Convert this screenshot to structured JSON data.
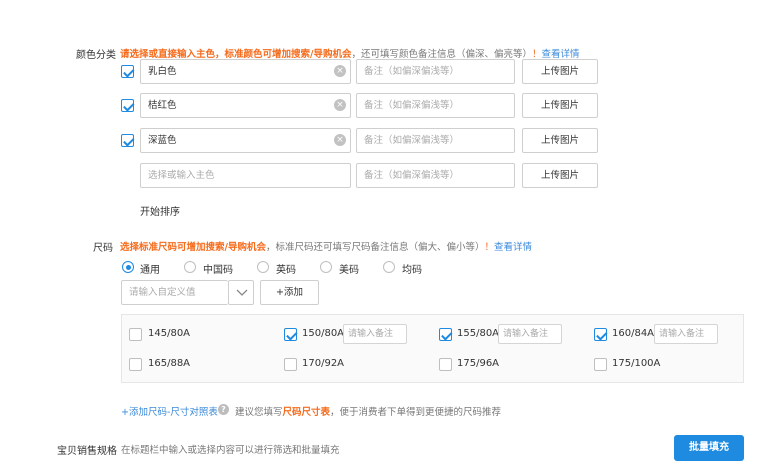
{
  "color_section": {
    "label": "颜色分类",
    "hint_orange": "请选择或直接输入主色，标准颜色可增加搜索/导购机会",
    "hint_gray": "，还可填写颜色备注信息（偏深、偏亮等）",
    "hint_excl": "！",
    "hint_link": "查看详情",
    "rows": [
      {
        "checked": true,
        "value": "乳白色",
        "note_placeholder": "备注（如偏深偏浅等）",
        "upload_label": "上传图片"
      },
      {
        "checked": true,
        "value": "桔红色",
        "note_placeholder": "备注（如偏深偏浅等）",
        "upload_label": "上传图片"
      },
      {
        "checked": true,
        "value": "深蓝色",
        "note_placeholder": "备注（如偏深偏浅等）",
        "upload_label": "上传图片"
      }
    ],
    "empty_row": {
      "placeholder": "选择或输入主色",
      "note_placeholder": "备注（如偏深偏浅等）",
      "upload_label": "上传图片"
    },
    "sort_label": "开始排序"
  },
  "size_section": {
    "label": "尺码",
    "hint_orange": "选择标准尺码可增加搜索/导购机会",
    "hint_gray": "，标准尺码还可填写尺码备注信息（偏大、偏小等）",
    "hint_excl": "！",
    "hint_link": "查看详情",
    "radios": [
      {
        "label": "通用",
        "selected": true
      },
      {
        "label": "中国码",
        "selected": false
      },
      {
        "label": "英码",
        "selected": false
      },
      {
        "label": "美码",
        "selected": false
      },
      {
        "label": "均码",
        "selected": false
      }
    ],
    "custom_placeholder": "请输入自定义值",
    "add_label": "+添加",
    "sizes": [
      {
        "label": "145/80A",
        "checked": false,
        "note_placeholder": ""
      },
      {
        "label": "150/80A",
        "checked": true,
        "note_placeholder": "请输入备注"
      },
      {
        "label": "155/80A",
        "checked": true,
        "note_placeholder": "请输入备注"
      },
      {
        "label": "160/84A",
        "checked": true,
        "note_placeholder": "请输入备注"
      },
      {
        "label": "165/88A",
        "checked": false,
        "note_placeholder": ""
      },
      {
        "label": "170/92A",
        "checked": false,
        "note_placeholder": ""
      },
      {
        "label": "175/96A",
        "checked": false,
        "note_placeholder": ""
      },
      {
        "label": "175/100A",
        "checked": false,
        "note_placeholder": ""
      }
    ],
    "add_chart_link": "+添加尺码-尺寸对照表",
    "chart_hint_pre": "建议您填写",
    "chart_hint_orange": "尺码尺寸表",
    "chart_hint_post": "，便于消费者下单得到更便捷的尺码推荐"
  },
  "sales_section": {
    "label": "宝贝销售规格",
    "hint": "在标题栏中输入或选择内容可以进行筛选和批量填充",
    "batch_button": "批量填充"
  },
  "colors": {
    "accent": "#1e8ae0",
    "orange": "#f56c1d",
    "link": "#3b8ad9"
  }
}
